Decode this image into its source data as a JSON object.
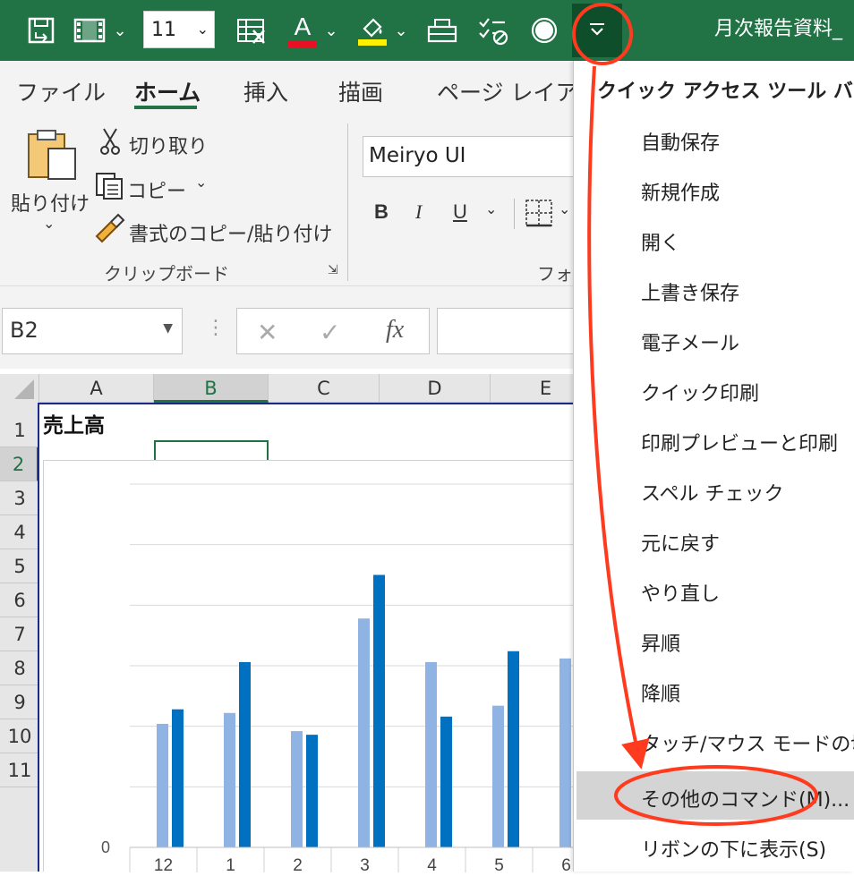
{
  "quick_access": {
    "font_size": "11",
    "title": "月次報告資料_"
  },
  "tabs": [
    "ファイル",
    "ホーム",
    "挿入",
    "描画",
    "ページ レイアウト"
  ],
  "ribbon": {
    "paste_label": "貼り付け",
    "cut_label": "切り取り",
    "copy_label": "コピー",
    "format_painter_label": "書式のコピー/貼り付け",
    "clipboard_group": "クリップボード",
    "font_name": "Meiryo UI",
    "font_group": "フォン",
    "bold": "B",
    "italic": "I",
    "underline": "U"
  },
  "formula_bar": {
    "name_box": "B2",
    "fx": "fx"
  },
  "grid": {
    "columns": [
      "A",
      "B",
      "C",
      "D",
      "E"
    ],
    "rows": [
      "1",
      "2",
      "3",
      "4",
      "5",
      "6",
      "7",
      "8",
      "9",
      "10",
      "11"
    ],
    "cell_A1": "売上高"
  },
  "chart_data": {
    "type": "bar",
    "categories": [
      "12",
      "1",
      "2",
      "3",
      "4",
      "5",
      "6"
    ],
    "series": [
      {
        "values": [
          17,
          18.5,
          16,
          31.5,
          25.5,
          19.5,
          26
        ],
        "color": "#8fb4e3"
      },
      {
        "values": [
          19,
          25.5,
          15.5,
          37.5,
          18,
          27,
          null
        ],
        "color": "#0070c0"
      }
    ],
    "y_tick_labels": [
      "0"
    ],
    "ylim": [
      0,
      50
    ],
    "grid": true
  },
  "menu": {
    "header": "クイック アクセス ツール バーの",
    "items": [
      "自動保存",
      "新規作成",
      "開く",
      "上書き保存",
      "電子メール",
      "クイック印刷",
      "印刷プレビューと印刷",
      "スペル チェック",
      "元に戻す",
      "やり直し",
      "昇順",
      "降順",
      "タッチ/マウス モードの切り",
      "その他のコマンド(M)...",
      "リボンの下に表示(S)"
    ]
  },
  "colors": {
    "excel_green": "#217346",
    "annotation_red": "#ff3b1f"
  }
}
